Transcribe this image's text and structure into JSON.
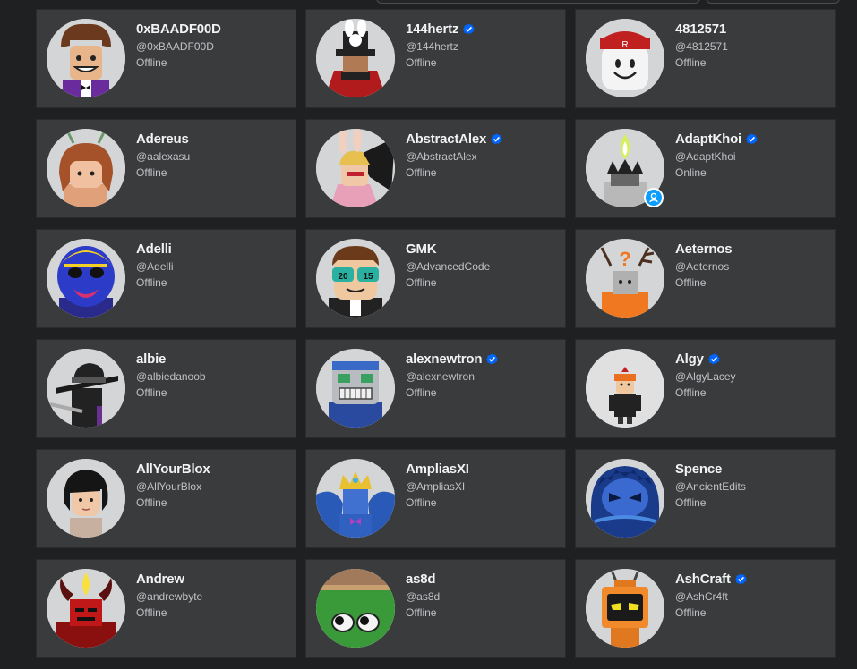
{
  "colors": {
    "page_bg": "#1f2022",
    "card_bg": "#393b3d",
    "verified_blue": "#0066ff",
    "online_blue": "#0a9cff"
  },
  "friends": [
    {
      "name": "0xBAADF00D",
      "handle": "@0xBAADF00D",
      "status": "Offline",
      "verified": false,
      "avatar": "brown-hair-purple-suit-avatar"
    },
    {
      "name": "144hertz",
      "handle": "@144hertz",
      "status": "Offline",
      "verified": true,
      "avatar": "bunny-top-hat-red-coat-avatar"
    },
    {
      "name": "4812571",
      "handle": "@4812571",
      "status": "Offline",
      "verified": false,
      "avatar": "white-smile-red-cap-avatar"
    },
    {
      "name": "Adereus",
      "handle": "@aalexasu",
      "status": "Offline",
      "verified": false,
      "avatar": "brown-hair-antennae-avatar"
    },
    {
      "name": "AbstractAlex",
      "handle": "@AbstractAlex",
      "status": "Offline",
      "verified": true,
      "avatar": "bunny-ears-dark-wings-avatar"
    },
    {
      "name": "AdaptKhoi",
      "handle": "@AdaptKhoi",
      "status": "Online",
      "verified": true,
      "avatar": "candle-flame-avatar",
      "online": true
    },
    {
      "name": "Adelli",
      "handle": "@Adelli",
      "status": "Offline",
      "verified": false,
      "avatar": "blue-yellow-mask-avatar"
    },
    {
      "name": "GMK",
      "handle": "@AdvancedCode",
      "status": "Offline",
      "verified": false,
      "avatar": "2015-glasses-avatar"
    },
    {
      "name": "Aeternos",
      "handle": "@Aeternos",
      "status": "Offline",
      "verified": false,
      "avatar": "question-mark-antlers-avatar"
    },
    {
      "name": "albie",
      "handle": "@albiedanoob",
      "status": "Offline",
      "verified": false,
      "avatar": "black-fedora-avatar"
    },
    {
      "name": "alexnewtron",
      "handle": "@alexnewtron",
      "status": "Offline",
      "verified": true,
      "avatar": "robot-grin-avatar"
    },
    {
      "name": "Algy",
      "handle": "@AlgyLacey",
      "status": "Offline",
      "verified": true,
      "avatar": "small-orange-cap-avatar"
    },
    {
      "name": "AllYourBlox",
      "handle": "@AllYourBlox",
      "status": "Offline",
      "verified": false,
      "avatar": "dark-bob-hair-avatar"
    },
    {
      "name": "AmpliasXI",
      "handle": "@AmpliasXI",
      "status": "Offline",
      "verified": false,
      "avatar": "gold-crown-blue-wings-avatar"
    },
    {
      "name": "Spence",
      "handle": "@AncientEdits",
      "status": "Offline",
      "verified": false,
      "avatar": "blue-hood-avatar"
    },
    {
      "name": "Andrew",
      "handle": "@andrewbyte",
      "status": "Offline",
      "verified": false,
      "avatar": "red-flame-horns-avatar"
    },
    {
      "name": "as8d",
      "handle": "@as8d",
      "status": "Offline",
      "verified": false,
      "avatar": "green-block-eyes-avatar"
    },
    {
      "name": "AshCraft",
      "handle": "@AshCr4ft",
      "status": "Offline",
      "verified": true,
      "avatar": "orange-tv-head-avatar"
    }
  ]
}
